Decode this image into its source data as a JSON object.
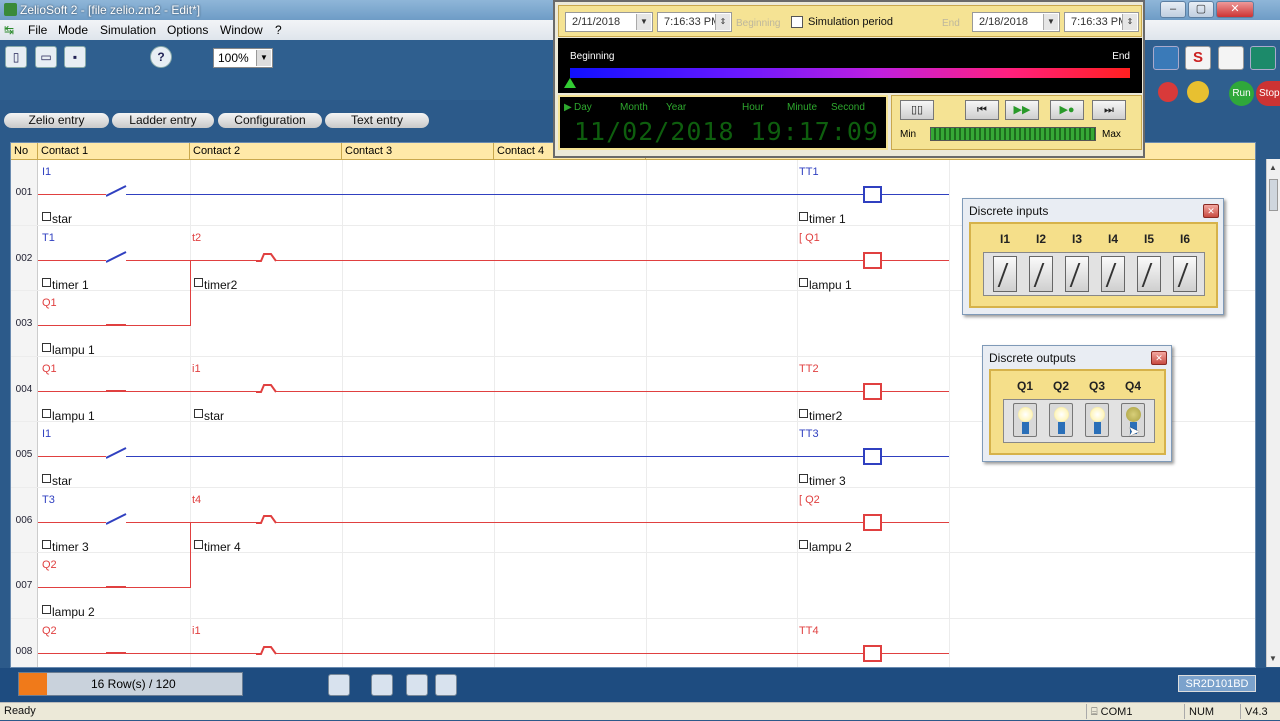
{
  "window": {
    "title": "ZelioSoft 2 - [file zelio.zm2 - Edit*]"
  },
  "menu": [
    "File",
    "Mode",
    "Simulation",
    "Options",
    "Window",
    "?"
  ],
  "toolbar": {
    "zoom": "100%",
    "help": "?",
    "run_label": "Run",
    "stop_label": "Stop"
  },
  "modes": [
    "Zelio entry",
    "Ladder entry",
    "Configuration",
    "Text entry"
  ],
  "columns": {
    "no": "No",
    "c1": "Contact 1",
    "c2": "Contact 2",
    "c3": "Contact 3",
    "c4": "Contact 4"
  },
  "rows": [
    {
      "num": "001",
      "c1_label": "I1",
      "c1_name": "star",
      "coil_label": "TT1",
      "coil_name": "timer 1"
    },
    {
      "num": "002",
      "c1_label": "T1",
      "c1_name": "timer 1",
      "c2_label": "t2",
      "c2_name": "timer2",
      "coil_label": "[ Q1",
      "coil_name": "lampu 1"
    },
    {
      "num": "003",
      "c1_label": "Q1",
      "c1_name": "lampu 1"
    },
    {
      "num": "004",
      "c1_label": "Q1",
      "c1_name": "lampu 1",
      "c2_label": "i1",
      "c2_name": "star",
      "coil_label": "TT2",
      "coil_name": "timer2"
    },
    {
      "num": "005",
      "c1_label": "I1",
      "c1_name": "star",
      "coil_label": "TT3",
      "coil_name": "timer 3"
    },
    {
      "num": "006",
      "c1_label": "T3",
      "c1_name": "timer 3",
      "c2_label": "t4",
      "c2_name": "timer 4",
      "coil_label": "[ Q2",
      "coil_name": "lampu 2"
    },
    {
      "num": "007",
      "c1_label": "Q2",
      "c1_name": "lampu 2"
    },
    {
      "num": "008",
      "c1_label": "Q2",
      "c2_label": "i1",
      "coil_label": "TT4"
    }
  ],
  "simulation": {
    "begin_date": "2/11/2018",
    "begin_time": "7:16:33 PM",
    "beginning_gray": "Beginning",
    "sim_period": "Simulation period",
    "end_gray": "End",
    "end_date": "2/18/2018",
    "end_time": "7:16:33 PM",
    "tl_begin": "Beginning",
    "tl_end": "End",
    "hdr": [
      "Day",
      "Month",
      "Year",
      "Hour",
      "Minute",
      "Second"
    ],
    "clock": "11/02/2018 19:17:09",
    "min": "Min",
    "max": "Max"
  },
  "discrete_inputs": {
    "title": "Discrete inputs",
    "labels": [
      "I1",
      "I2",
      "I3",
      "I4",
      "I5",
      "I6"
    ]
  },
  "discrete_outputs": {
    "title": "Discrete outputs",
    "labels": [
      "Q1",
      "Q2",
      "Q3",
      "Q4"
    ]
  },
  "status": {
    "rowcount": "16 Row(s) / 120",
    "model": "SR2D101BD"
  },
  "readybar": {
    "ready": "Ready",
    "com": "COM1",
    "num": "NUM",
    "version": "V4.3"
  },
  "colors": {
    "rung_red": "#e04040",
    "rung_blue": "#3040c0",
    "accent": "#2f5f8f"
  }
}
